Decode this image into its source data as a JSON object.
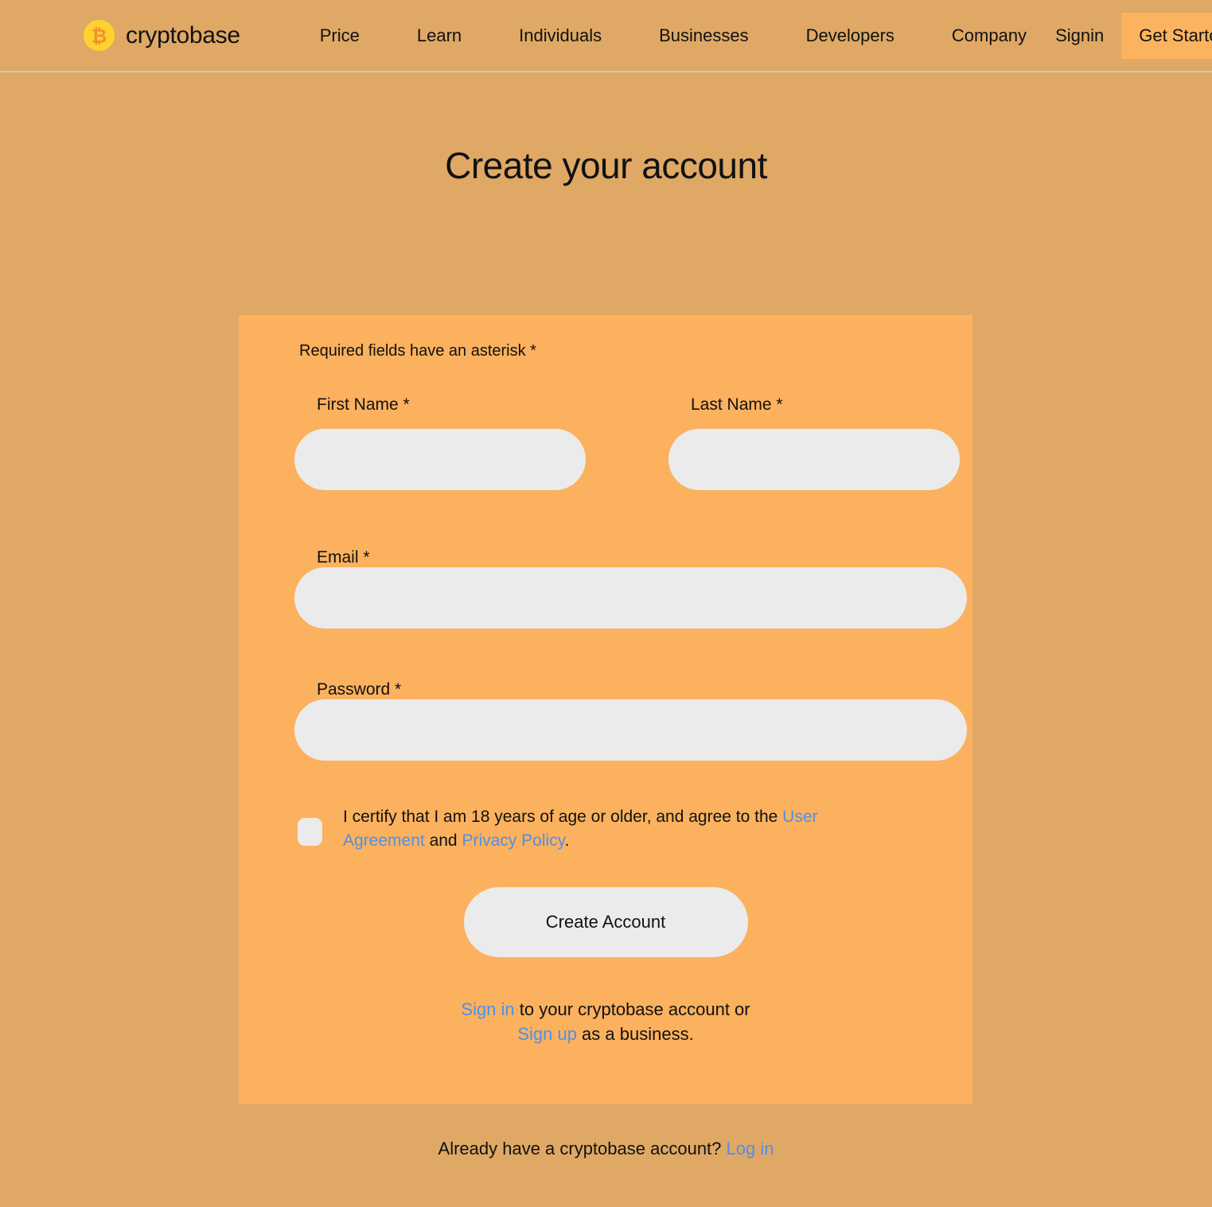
{
  "navbar": {
    "brand": {
      "name": "cryptobase",
      "logo_icon": "bitcoin-icon",
      "logo_bg_color": "#ffd22f",
      "logo_symbol_color": "#f0922b",
      "symbol": "₿"
    },
    "links": [
      {
        "label": "Price"
      },
      {
        "label": "Learn"
      },
      {
        "label": "Individuals"
      },
      {
        "label": "Businesses"
      },
      {
        "label": "Developers"
      },
      {
        "label": "Company"
      }
    ],
    "signin_label": "Signin",
    "get_started_label": "Get Started",
    "get_started_bg": "#fbb35f"
  },
  "page": {
    "title": "Create your account",
    "background_color": "#dfa865"
  },
  "card": {
    "background_color": "#fbb15e",
    "required_note": "Required fields have an asterisk *",
    "fields": {
      "first_name": {
        "label": "First Name *",
        "value": "",
        "placeholder": ""
      },
      "last_name": {
        "label": "Last Name *",
        "value": "",
        "placeholder": ""
      },
      "email": {
        "label": "Email *",
        "value": "",
        "placeholder": ""
      },
      "password": {
        "label": "Password *",
        "value": "",
        "placeholder": ""
      }
    },
    "consent": {
      "checked": false,
      "text_part1": "I certify that I am 18 years of age or older, and agree to the ",
      "user_agreement_link": "User Agreement",
      "text_part2": " and ",
      "privacy_policy_link": "Privacy Policy",
      "text_part3": "."
    },
    "submit_label": "Create Account",
    "alt_actions": {
      "sign_in_link": "Sign in",
      "sign_in_tail": " to your cryptobase account or",
      "sign_up_link": "Sign up",
      "sign_up_tail": " as a business."
    }
  },
  "footer": {
    "text": "Already have a cryptobase account? ",
    "login_link": "Log in"
  },
  "colors": {
    "link_blue": "#4f90e8",
    "input_gray": "#ebebeb",
    "text_dark": "#111111"
  }
}
